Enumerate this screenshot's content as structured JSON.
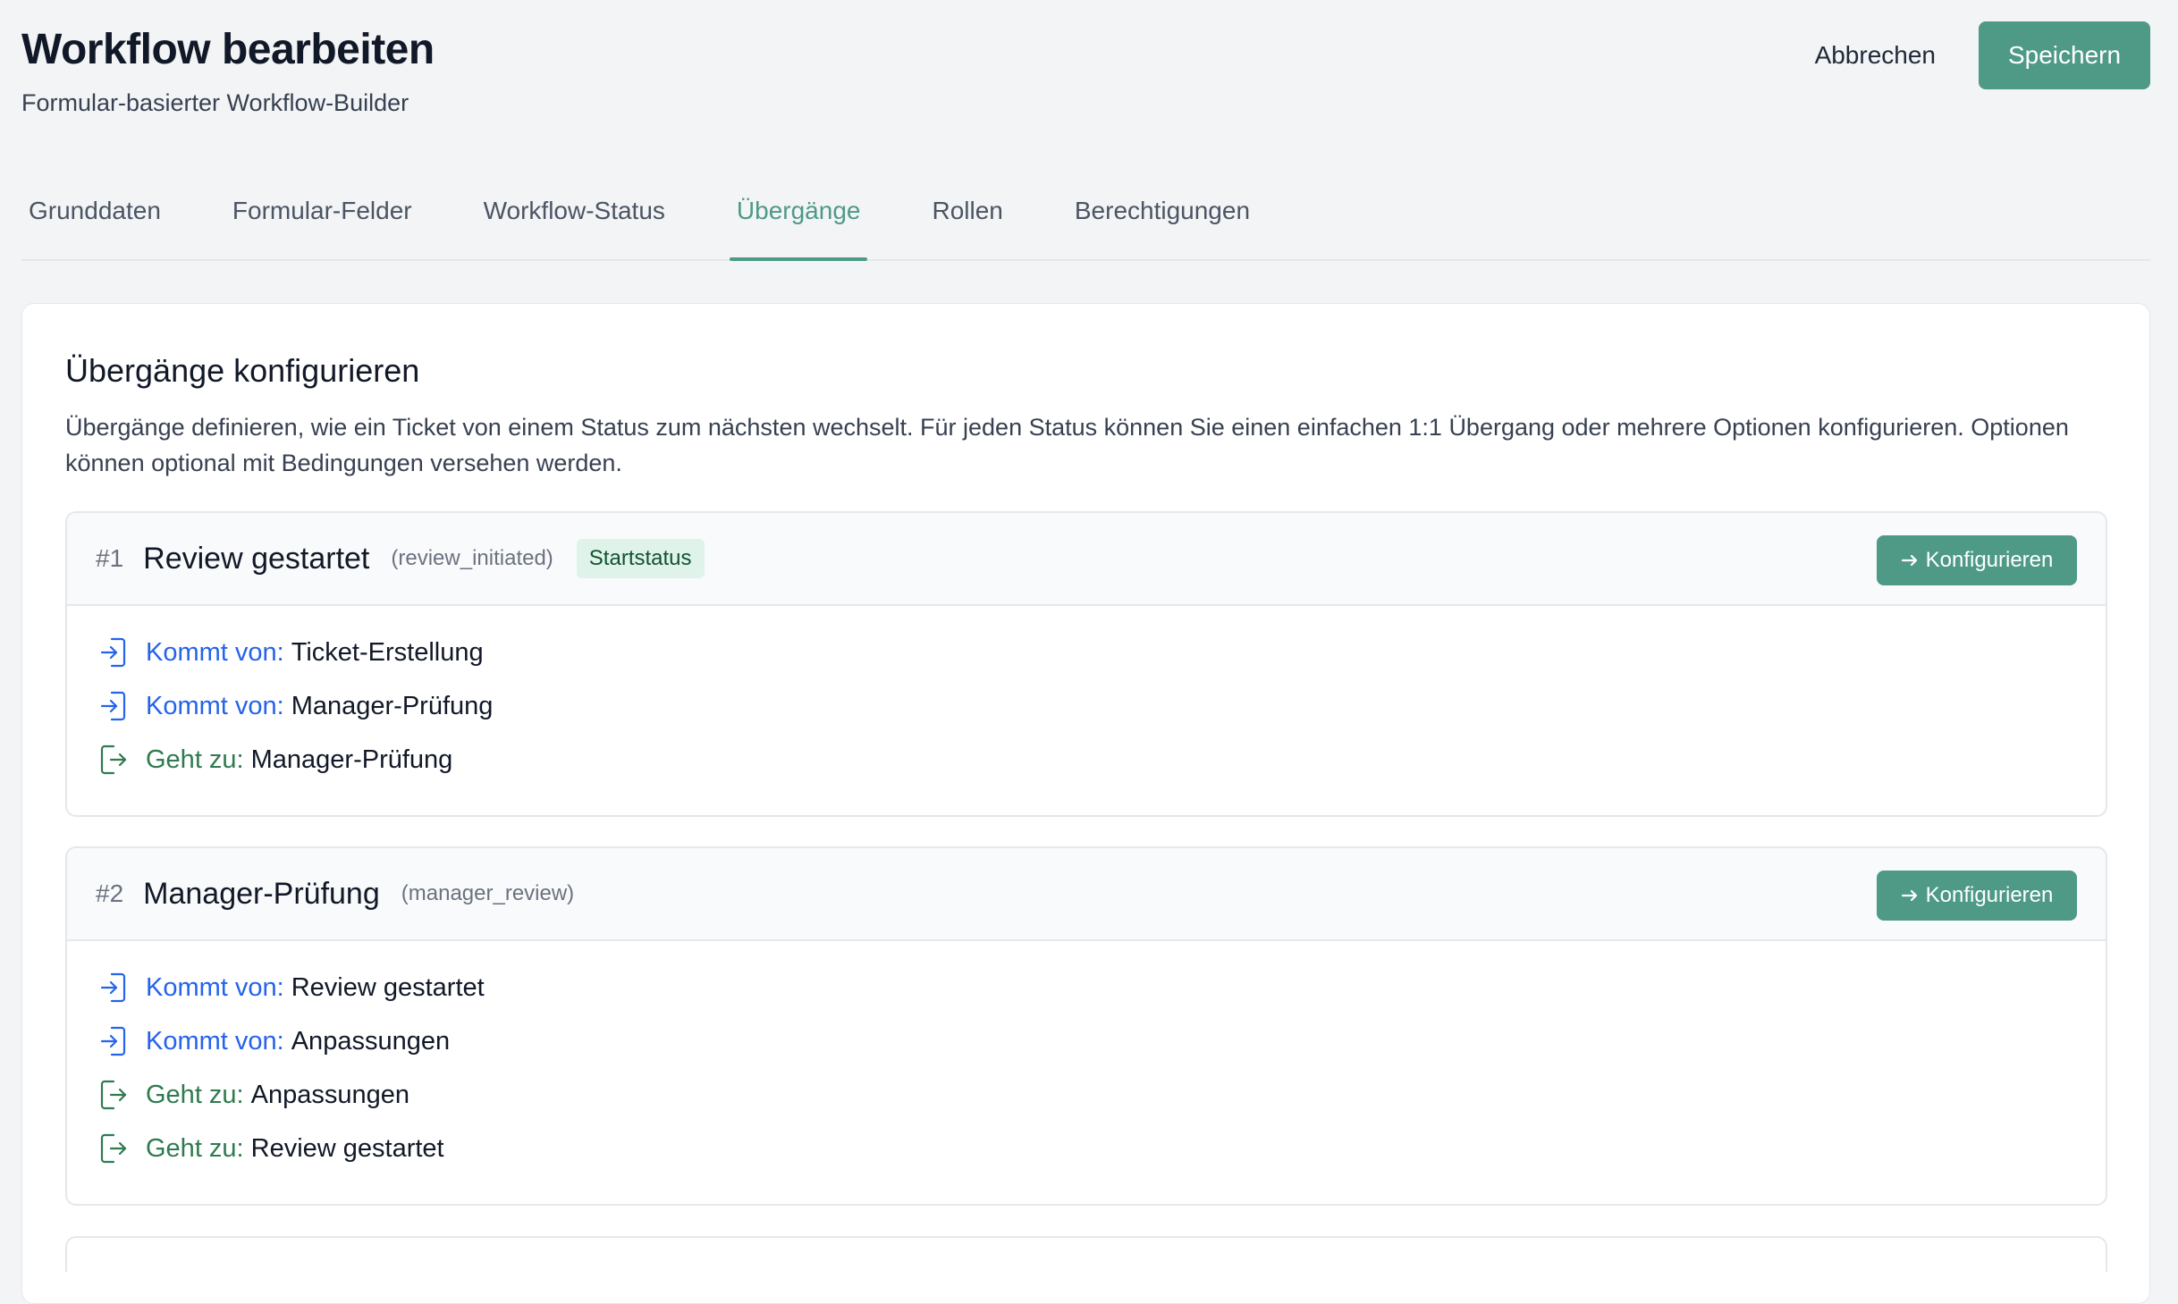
{
  "header": {
    "title": "Workflow bearbeiten",
    "subtitle": "Formular-basierter Workflow-Builder",
    "cancel_label": "Abbrechen",
    "save_label": "Speichern"
  },
  "tabs": [
    {
      "label": "Grunddaten"
    },
    {
      "label": "Formular-Felder"
    },
    {
      "label": "Workflow-Status"
    },
    {
      "label": "Übergänge"
    },
    {
      "label": "Rollen"
    },
    {
      "label": "Berechtigungen"
    }
  ],
  "active_tab": "Übergänge",
  "card": {
    "title": "Übergänge konfigurieren",
    "description": "Übergänge definieren, wie ein Ticket von einem Status zum nächsten wechselt. Für jeden Status können Sie einen einfachen 1:1 Übergang oder mehrere Optionen konfigurieren. Optionen können optional mit Bedingungen versehen werden."
  },
  "transitions": [
    {
      "number": "#1",
      "name": "Review gestartet",
      "key": "(review_initiated)",
      "badge": "Startstatus",
      "configure_label": "Konfigurieren",
      "incoming_label": "Kommt von:",
      "outgoing_label": "Geht zu:",
      "incoming": [
        "Ticket-Erstellung",
        "Manager-Prüfung"
      ],
      "outgoing": [
        "Manager-Prüfung"
      ]
    },
    {
      "number": "#2",
      "name": "Manager-Prüfung",
      "key": "(manager_review)",
      "badge": "",
      "configure_label": "Konfigurieren",
      "incoming_label": "Kommt von:",
      "outgoing_label": "Geht zu:",
      "incoming": [
        "Review gestartet",
        "Anpassungen"
      ],
      "outgoing": [
        "Anpassungen",
        "Review gestartet"
      ]
    }
  ],
  "colors": {
    "accent": "#4e9a87",
    "incoming": "#2563eb",
    "outgoing": "#2f7a4f",
    "badge_bg": "#dff3ea"
  },
  "icons": {
    "incoming": "login-icon",
    "outgoing": "logout-icon",
    "configure": "arrow-right-icon"
  }
}
